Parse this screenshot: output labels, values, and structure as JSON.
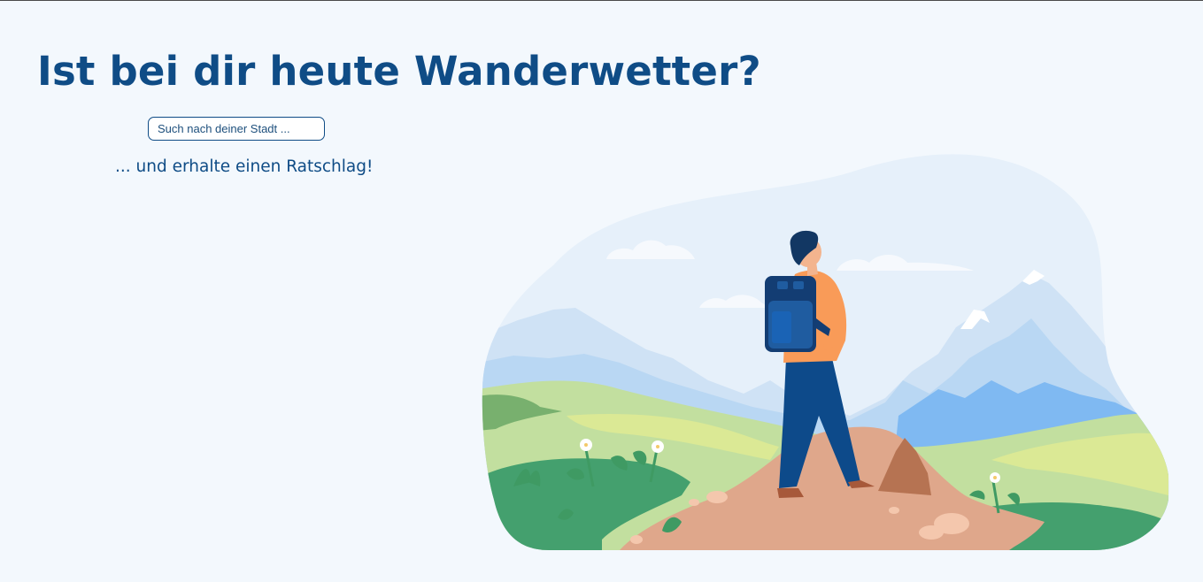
{
  "header": {
    "title": "Ist bei dir heute Wanderwetter?"
  },
  "search": {
    "placeholder": "Such nach deiner Stadt ..."
  },
  "subtitle": "... und erhalte einen Ratschlag!",
  "colors": {
    "background": "#f3f8fd",
    "primary": "#0f4c86"
  },
  "illustration": {
    "subject": "hiker-with-backpack-looking-at-mountains"
  }
}
